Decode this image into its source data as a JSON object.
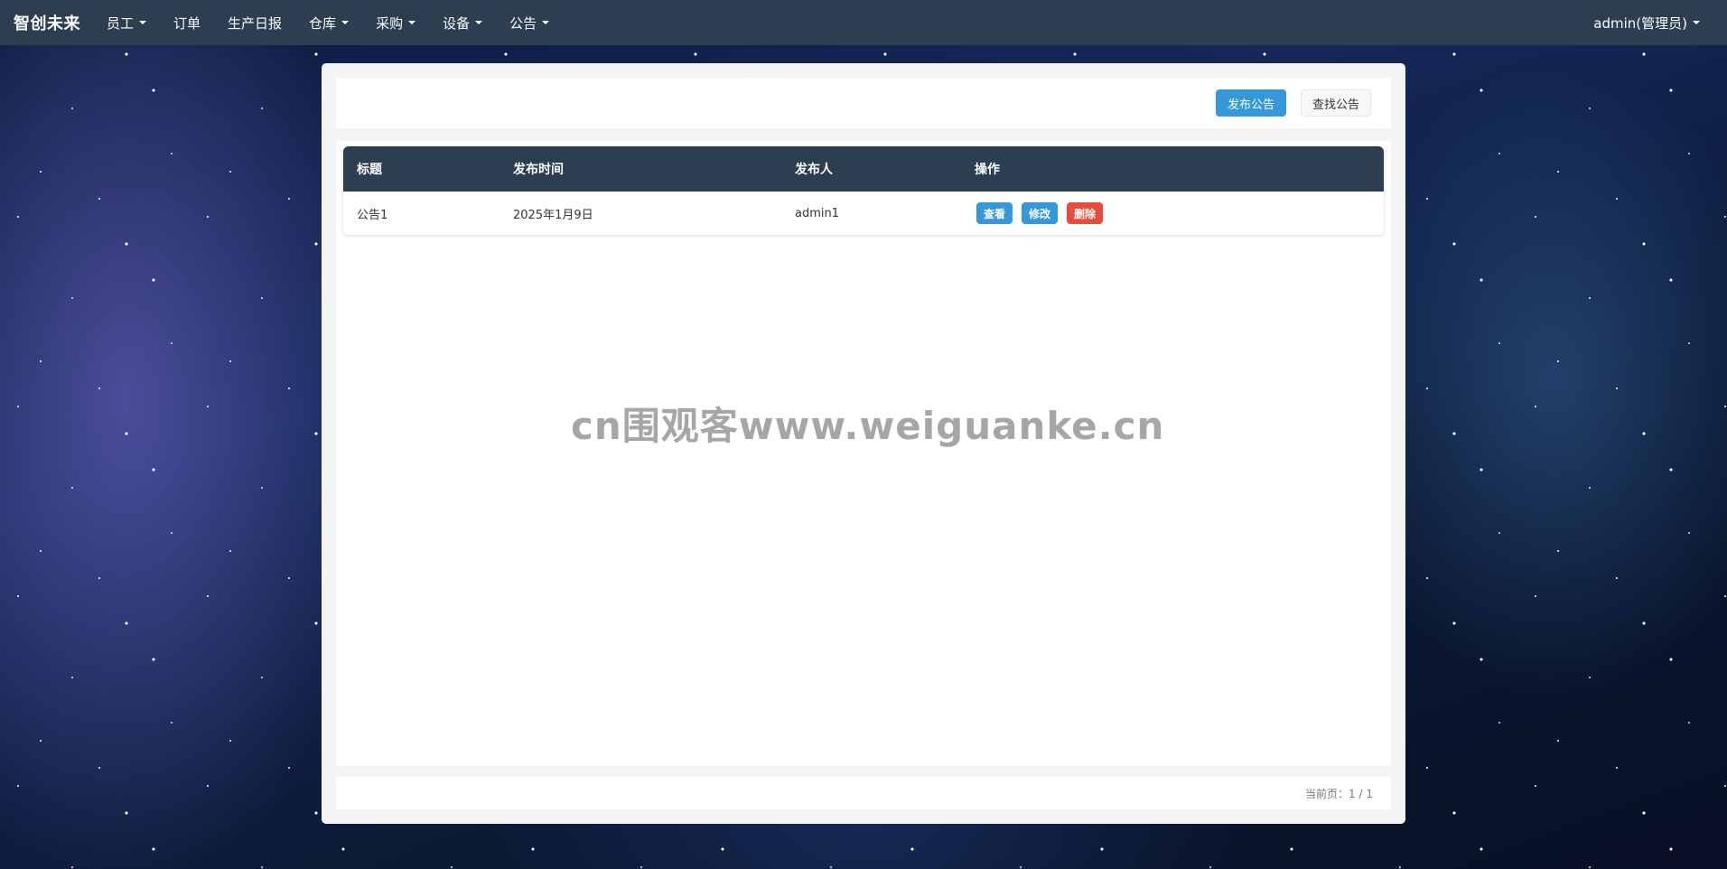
{
  "navbar": {
    "brand": "智创未来",
    "items": [
      {
        "label": "员工",
        "dropdown": true
      },
      {
        "label": "订单",
        "dropdown": false
      },
      {
        "label": "生产日报",
        "dropdown": false
      },
      {
        "label": "仓库",
        "dropdown": true
      },
      {
        "label": "采购",
        "dropdown": true
      },
      {
        "label": "设备",
        "dropdown": true
      },
      {
        "label": "公告",
        "dropdown": true
      }
    ],
    "user": "admin(管理员)"
  },
  "toolbar": {
    "publish_label": "发布公告",
    "search_label": "查找公告"
  },
  "table": {
    "headers": [
      "标题",
      "发布时间",
      "发布人",
      "操作"
    ],
    "rows": [
      {
        "title": "公告1",
        "time": "2025年1月9日",
        "publisher": "admin1"
      }
    ],
    "actions": {
      "view": "查看",
      "edit": "修改",
      "delete": "删除"
    }
  },
  "watermark": "cn围观客www.weiguanke.cn",
  "pagination": {
    "text": "当前页：1 / 1"
  },
  "colors": {
    "navbar": "#2c3e50",
    "primary": "#3498db",
    "danger": "#e74c3c"
  }
}
